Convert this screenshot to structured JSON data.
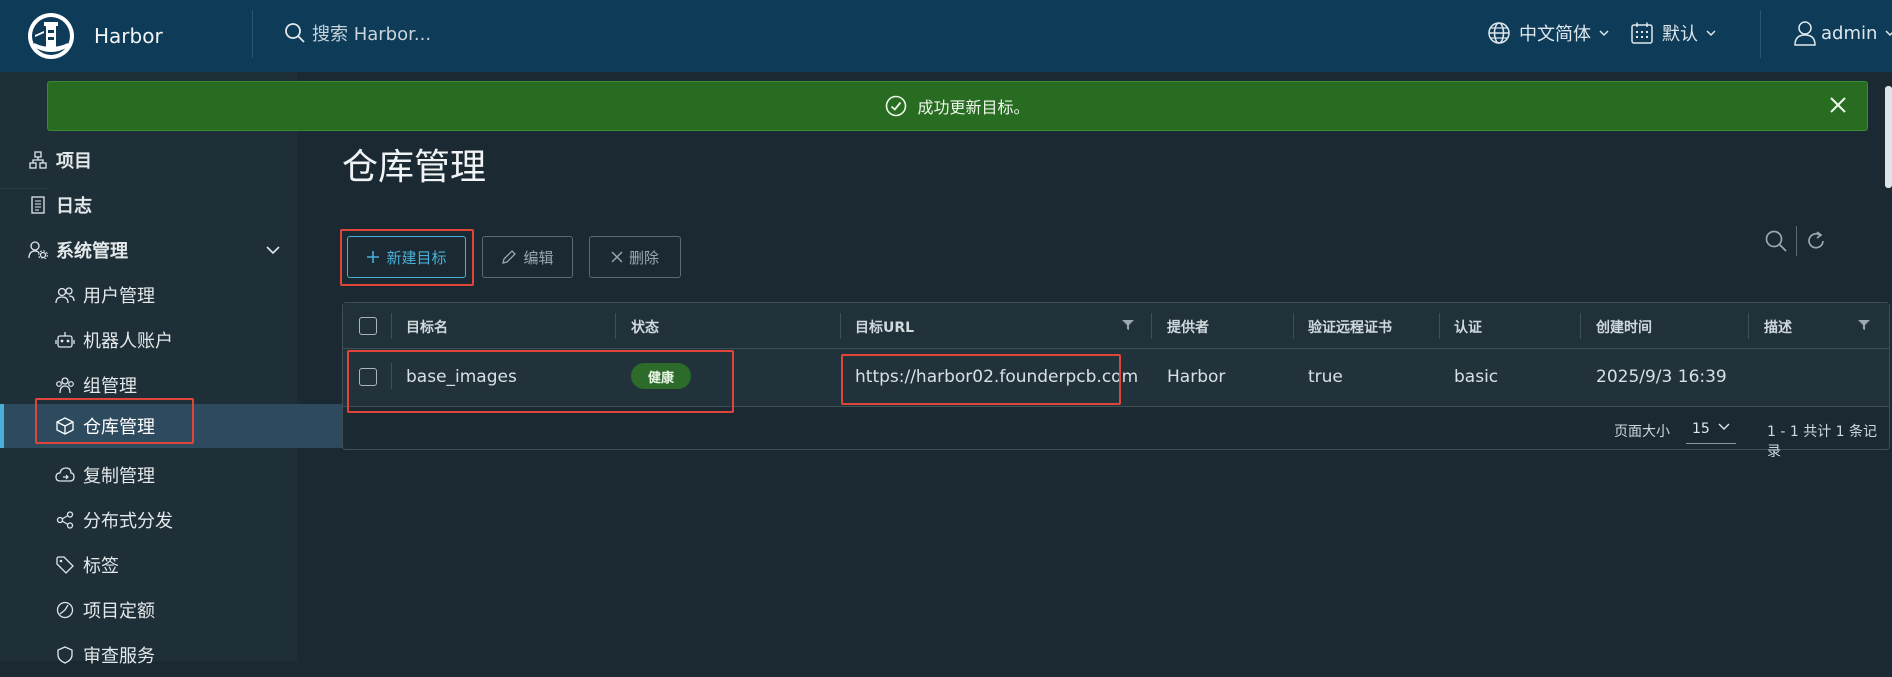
{
  "header": {
    "brand": "Harbor",
    "search_placeholder": "搜索 Harbor...",
    "language": "中文简体",
    "date_format": "默认",
    "user": "admin"
  },
  "alert": {
    "message": "成功更新目标。"
  },
  "sidebar": {
    "items": [
      {
        "label": "项目",
        "icon": "projects-icon"
      },
      {
        "label": "日志",
        "icon": "logs-icon"
      },
      {
        "label": "系统管理",
        "icon": "admin-icon",
        "expanded": true
      }
    ],
    "sub_items": [
      {
        "label": "用户管理",
        "icon": "users-icon"
      },
      {
        "label": "机器人账户",
        "icon": "robot-icon"
      },
      {
        "label": "组管理",
        "icon": "groups-icon"
      },
      {
        "label": "仓库管理",
        "icon": "registry-icon",
        "active": true
      },
      {
        "label": "复制管理",
        "icon": "replication-icon"
      },
      {
        "label": "分布式分发",
        "icon": "distribution-icon"
      },
      {
        "label": "标签",
        "icon": "tag-icon"
      },
      {
        "label": "项目定额",
        "icon": "quota-icon"
      },
      {
        "label": "审查服务",
        "icon": "shield-icon"
      }
    ]
  },
  "main": {
    "title": "仓库管理",
    "buttons": {
      "new": "新建目标",
      "edit": "编辑",
      "delete": "删除"
    }
  },
  "table": {
    "columns": [
      "目标名",
      "状态",
      "目标URL",
      "提供者",
      "验证远程证书",
      "认证",
      "创建时间",
      "描述"
    ],
    "rows": [
      {
        "name": "base_images",
        "status": "健康",
        "url": "https://harbor02.founderpcb.com",
        "provider": "Harbor",
        "verify_cert": "true",
        "auth": "basic",
        "created": "2025/9/3 16:39",
        "description": ""
      }
    ],
    "footer": {
      "page_size_label": "页面大小",
      "page_size": "15",
      "summary": "1 - 1 共计 1 条记录"
    }
  },
  "colors": {
    "header_bg": "#0d3b58",
    "sidebar_bg": "#1f2f37",
    "content_bg": "#1b2a32",
    "alert_bg": "#286c22",
    "accent": "#49afd9",
    "highlight": "#e0453a",
    "badge_bg": "#2c6b2a"
  }
}
